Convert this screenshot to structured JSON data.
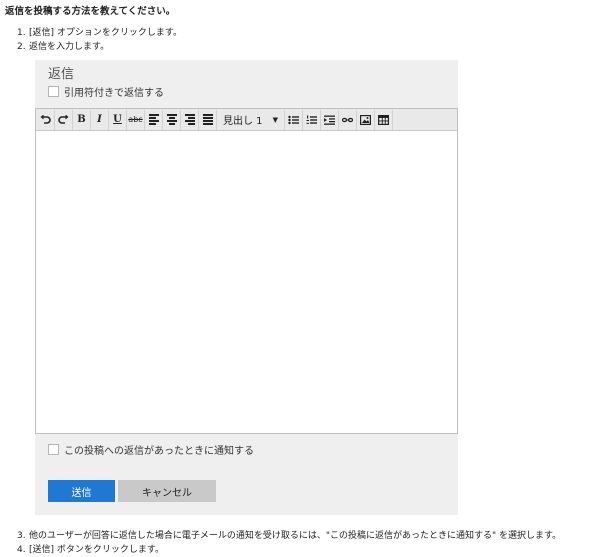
{
  "heading": "返信を投稿する方法を教えてください。",
  "steps_top": [
    {
      "num": "1.",
      "text": "[返信] オプションをクリックします。"
    },
    {
      "num": "2.",
      "text": "返信を入力します。"
    }
  ],
  "panel": {
    "title": "返信",
    "quote_checkbox": "引用符付きで返信する",
    "toolbar": {
      "bold": "B",
      "italic": "I",
      "underline": "U",
      "strike": "abc",
      "heading_select": "見出し 1",
      "heading_caret": "▼"
    },
    "notify_checkbox": "この投稿への返信があったときに通知する",
    "send_button": "送信",
    "cancel_button": "キャンセル"
  },
  "steps_bottom": [
    {
      "num": "3.",
      "text": "他のユーザーが回答に返信した場合に電子メールの通知を受け取るには、\"この投稿に返信があったときに通知する\" を選択します。"
    },
    {
      "num": "4.",
      "text": "[送信] ボタンをクリックします。"
    }
  ]
}
